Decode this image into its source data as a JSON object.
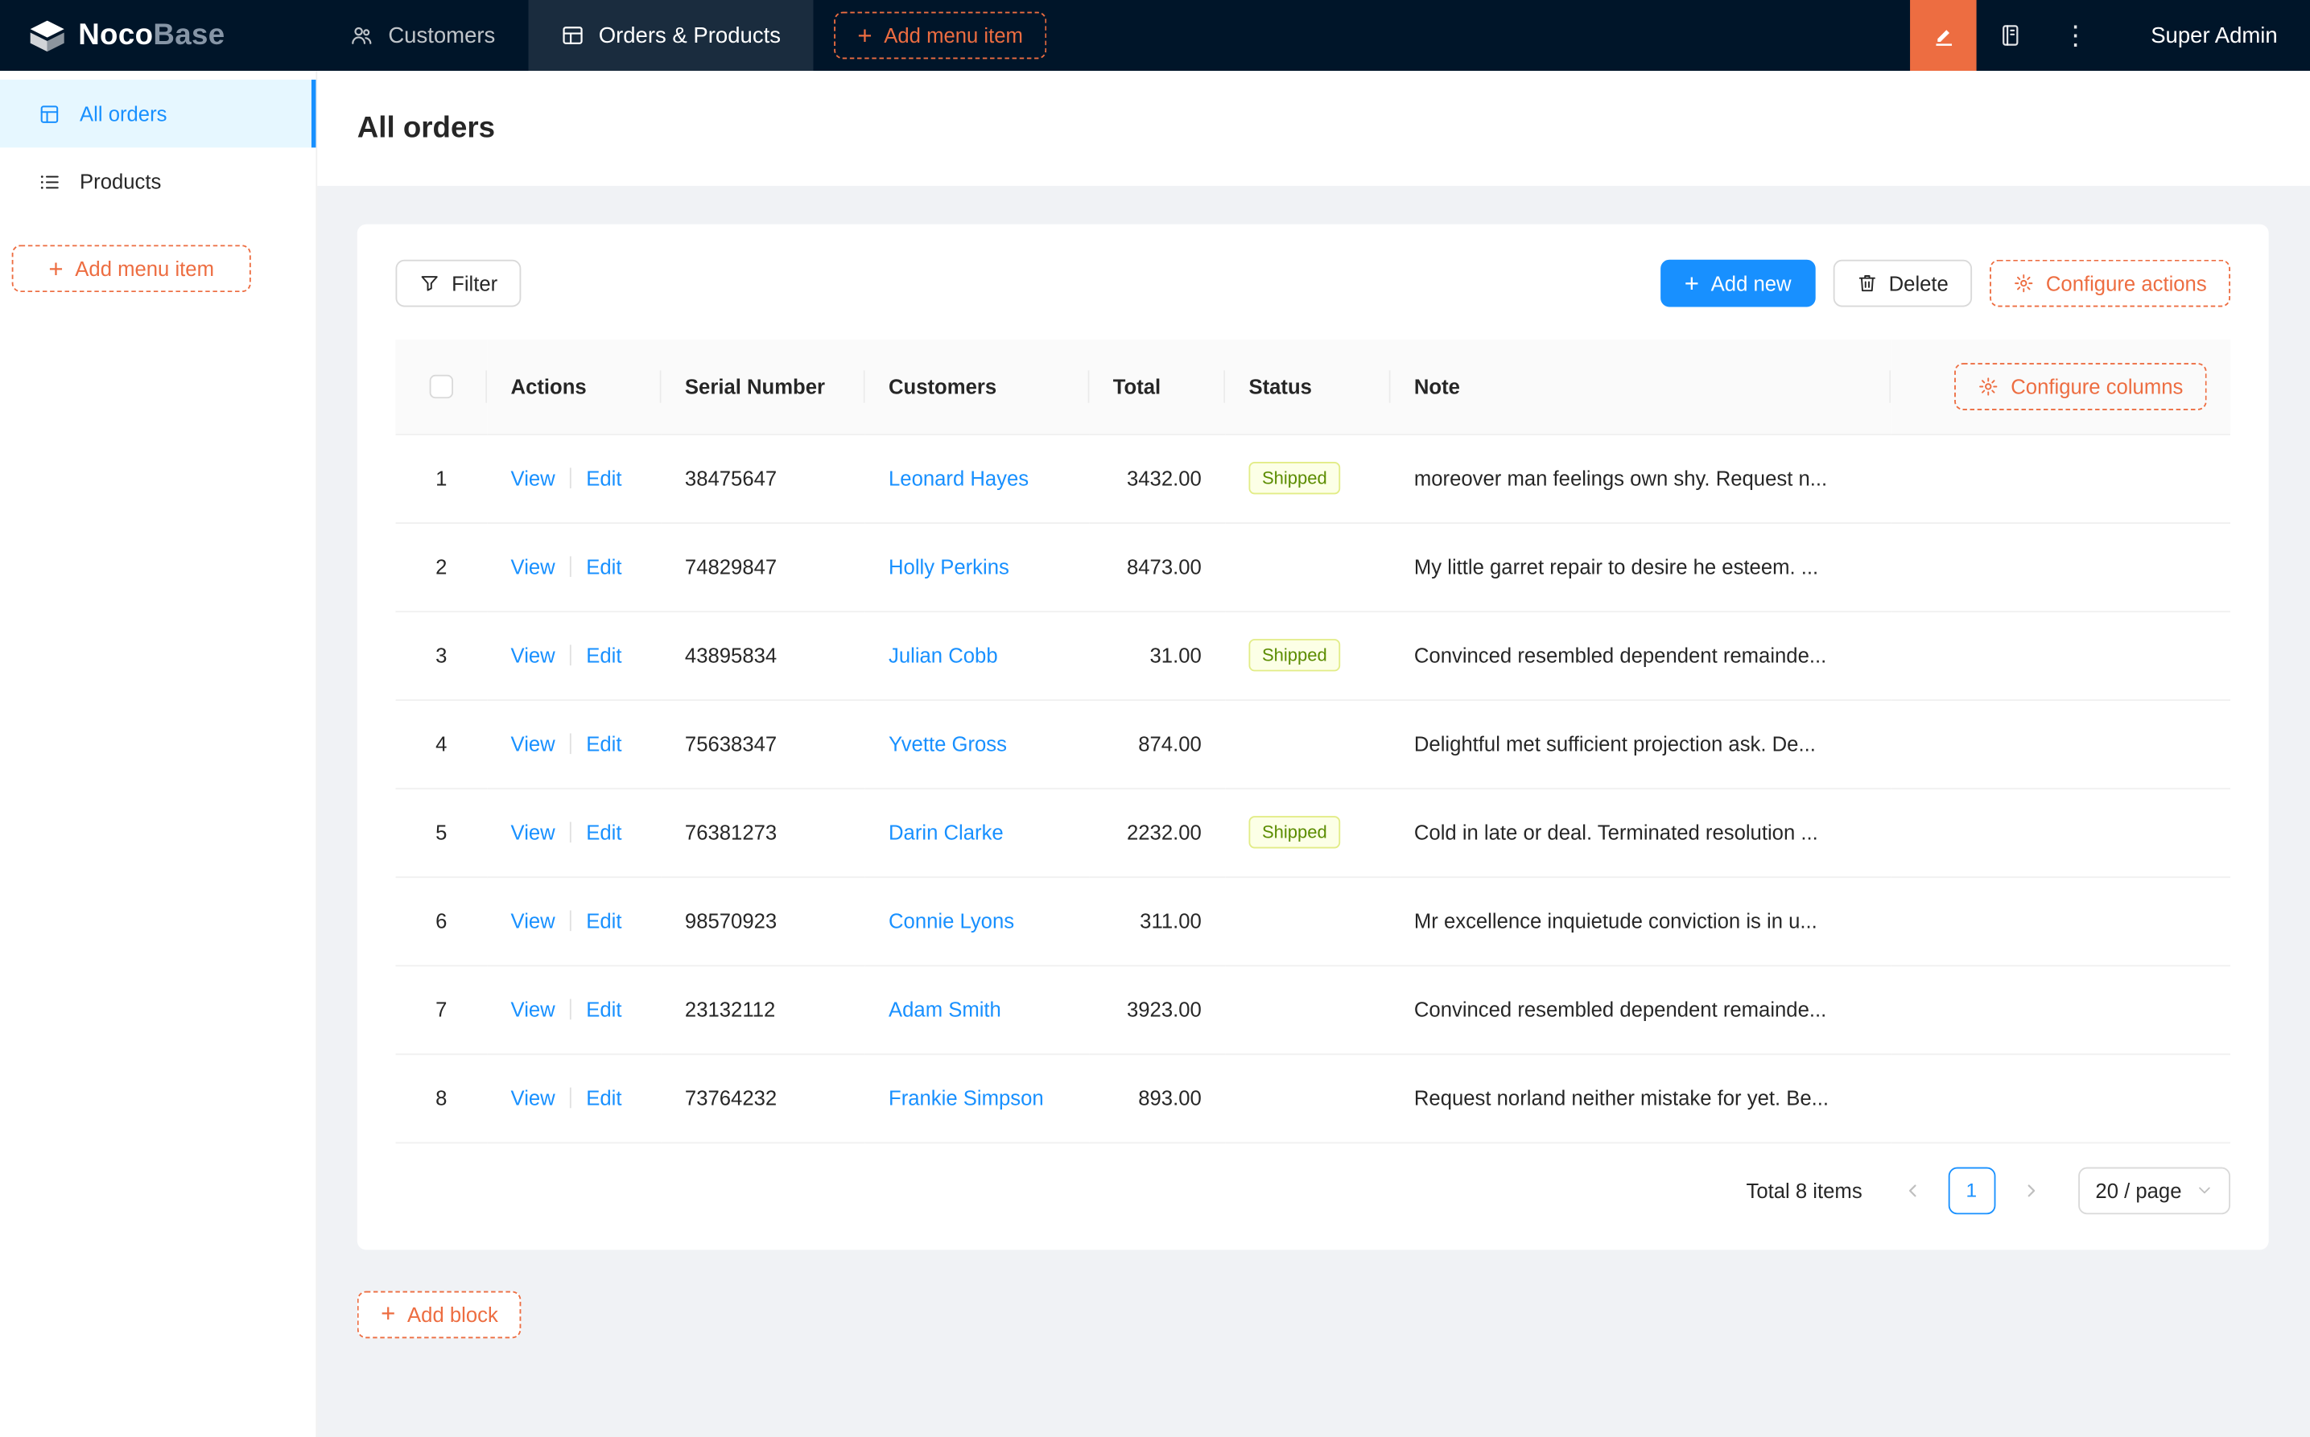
{
  "colors": {
    "header_bg": "#001529",
    "accent_orange": "#ED6D41",
    "primary_blue": "#1890FF",
    "sidebar_active_bg": "#E6F7FF",
    "content_bg": "#F0F2F5",
    "status_shipped_bg": "#FCFFE6",
    "status_shipped_border": "#E2EC87",
    "status_shipped_text": "#5B8C00"
  },
  "header": {
    "brand": {
      "primary": "Noco",
      "secondary": "Base"
    },
    "nav": [
      {
        "label": "Customers",
        "icon": "team-icon"
      },
      {
        "label": "Orders & Products",
        "icon": "table-icon"
      }
    ],
    "add_menu_item_label": "Add menu item",
    "icons": [
      "highlighter-icon",
      "book-icon",
      "ellipsis-icon"
    ],
    "user_name": "Super Admin"
  },
  "sidebar": {
    "items": [
      {
        "label": "All orders",
        "icon": "file-table-icon"
      },
      {
        "label": "Products",
        "icon": "list-icon"
      }
    ],
    "add_menu_item_label": "Add menu item"
  },
  "page": {
    "title": "All orders"
  },
  "toolbar": {
    "filter_label": "Filter",
    "add_new_label": "Add new",
    "delete_label": "Delete",
    "configure_actions_label": "Configure actions"
  },
  "table": {
    "column_labels": [
      "Actions",
      "Serial Number",
      "Customers",
      "Total",
      "Status",
      "Note"
    ],
    "configure_columns_label": "Configure columns",
    "action_labels": {
      "view": "View",
      "edit": "Edit"
    },
    "rows": [
      {
        "index": "1",
        "serial": "38475647",
        "customer": "Leonard Hayes",
        "total": "3432.00",
        "status": "Shipped",
        "note": "moreover man feelings own shy. Request n..."
      },
      {
        "index": "2",
        "serial": "74829847",
        "customer": "Holly Perkins",
        "total": "8473.00",
        "status": "",
        "note": "My little garret repair to desire he esteem. ..."
      },
      {
        "index": "3",
        "serial": "43895834",
        "customer": "Julian Cobb",
        "total": "31.00",
        "status": "Shipped",
        "note": "Convinced resembled dependent remainde..."
      },
      {
        "index": "4",
        "serial": "75638347",
        "customer": "Yvette Gross",
        "total": "874.00",
        "status": "",
        "note": "Delightful met sufficient projection ask. De..."
      },
      {
        "index": "5",
        "serial": "76381273",
        "customer": "Darin Clarke",
        "total": "2232.00",
        "status": "Shipped",
        "note": "Cold in late or deal. Terminated resolution ..."
      },
      {
        "index": "6",
        "serial": "98570923",
        "customer": "Connie Lyons",
        "total": "311.00",
        "status": "",
        "note": "Mr excellence inquietude conviction is in u..."
      },
      {
        "index": "7",
        "serial": "23132112",
        "customer": "Adam Smith",
        "total": "3923.00",
        "status": "",
        "note": "Convinced resembled dependent remainde..."
      },
      {
        "index": "8",
        "serial": "73764232",
        "customer": "Frankie Simpson",
        "total": "893.00",
        "status": "",
        "note": "Request norland neither mistake for yet. Be..."
      }
    ]
  },
  "pagination": {
    "total_label": "Total 8 items",
    "current_page": "1",
    "page_size_label": "20 / page"
  },
  "add_block_label": "Add block"
}
